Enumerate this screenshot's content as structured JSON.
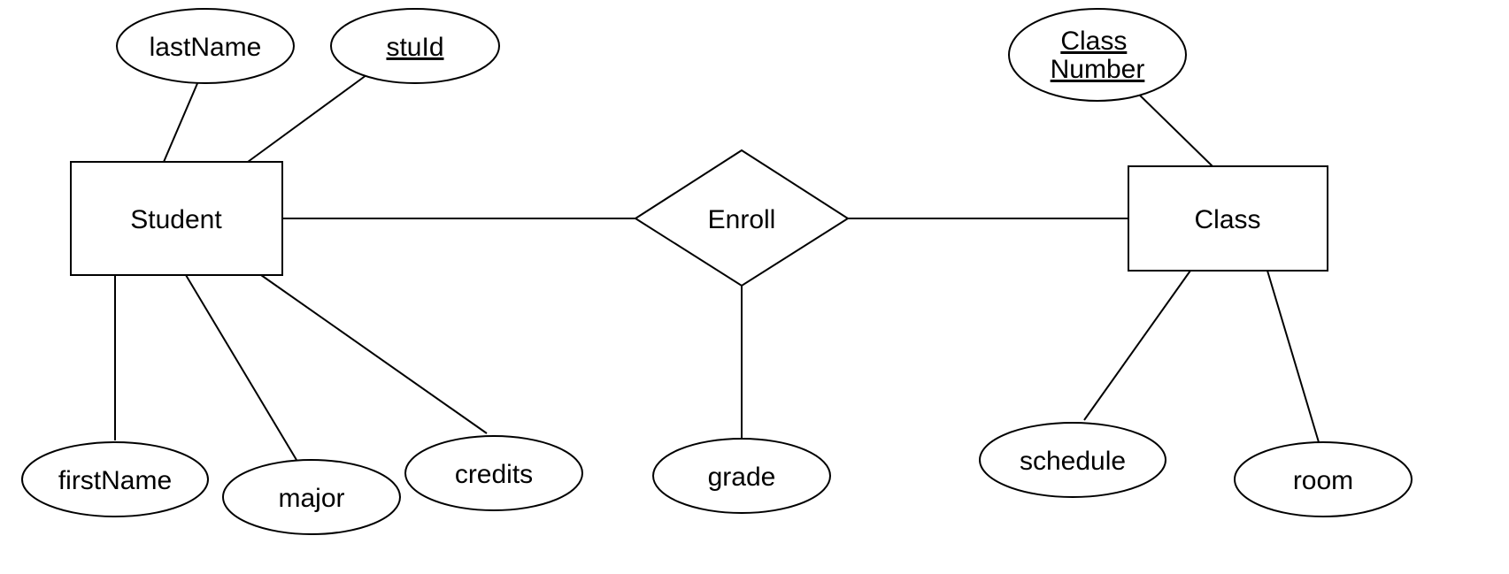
{
  "entities": {
    "student": {
      "label": "Student"
    },
    "class": {
      "label": "Class"
    }
  },
  "relationship": {
    "enroll": {
      "label": "Enroll"
    }
  },
  "attributes": {
    "lastName": {
      "label": "lastName",
      "key": false,
      "of": "student"
    },
    "stuId": {
      "label": "stuId",
      "key": true,
      "of": "student"
    },
    "firstName": {
      "label": "firstName",
      "key": false,
      "of": "student"
    },
    "major": {
      "label": "major",
      "key": false,
      "of": "student"
    },
    "credits": {
      "label": "credits",
      "key": false,
      "of": "student"
    },
    "grade": {
      "label": "grade",
      "key": false,
      "of": "enroll"
    },
    "classNumber": {
      "label": "Class Number",
      "key": true,
      "of": "class"
    },
    "schedule": {
      "label": "schedule",
      "key": false,
      "of": "class"
    },
    "room": {
      "label": "room",
      "key": false,
      "of": "class"
    }
  }
}
